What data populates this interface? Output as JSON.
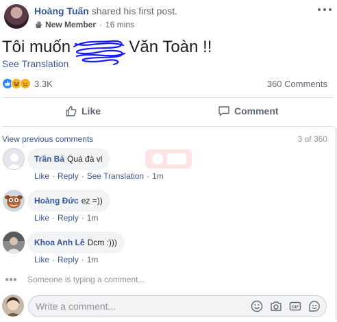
{
  "post": {
    "author": "Hoàng Tuấn",
    "action": "shared his first post.",
    "badge": "New Member",
    "time": "16 mins",
    "text_before": "Tôi muốn",
    "text_after": "Văn Toàn !!",
    "see_translation": "See Translation",
    "reaction_count": "3.3K",
    "comment_count": "360 Comments"
  },
  "actions": {
    "like": "Like",
    "comment": "Comment"
  },
  "comments": {
    "view_previous": "View previous comments",
    "count": "3 of 360",
    "like": "Like",
    "reply": "Reply",
    "see_translation": "See Translation",
    "items": [
      {
        "name": "Trần Bá",
        "text": "Quá đà vl",
        "time": "1m"
      },
      {
        "name": "Hoàng Đức",
        "text": "ez =))",
        "time": "1m"
      },
      {
        "name": "Khoa Anh Lê",
        "text": "Dcm :)))",
        "time": "1m"
      }
    ]
  },
  "typing": "Someone is typing a comment...",
  "composer": {
    "placeholder": "Write a comment..."
  },
  "colors": {
    "link": "#385898",
    "like_blue": "#2d88ff",
    "scribble": "#1a1aff"
  }
}
